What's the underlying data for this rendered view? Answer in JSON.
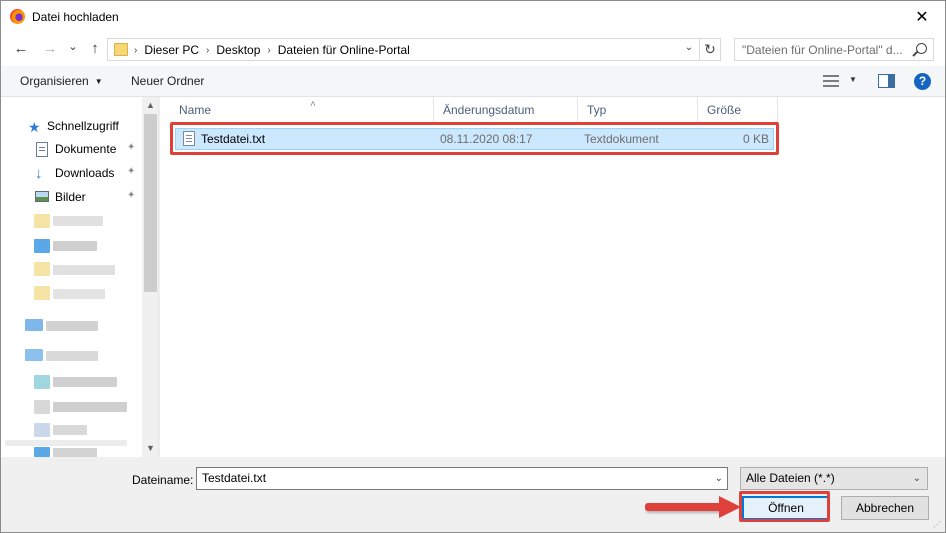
{
  "window": {
    "title": "Datei hochladen",
    "close_glyph": "✕"
  },
  "navigation": {
    "back_glyph": "←",
    "forward_glyph": "→",
    "recent_glyph": "⌄",
    "up_glyph": "↑",
    "breadcrumb": [
      "Dieser PC",
      "Desktop",
      "Dateien für Online-Portal"
    ],
    "refresh_glyph": "↻",
    "search_placeholder": "\"Dateien für Online-Portal\" d..."
  },
  "toolbar": {
    "organize_label": "Organisieren",
    "new_folder_label": "Neuer Ordner",
    "help_label": "?"
  },
  "sidebar": {
    "items": [
      {
        "label": "Schnellzugriff",
        "icon": "star-icon"
      },
      {
        "label": "Dokumente",
        "icon": "document-icon",
        "pinned": true
      },
      {
        "label": "Downloads",
        "icon": "download-icon",
        "pinned": true
      },
      {
        "label": "Bilder",
        "icon": "pictures-icon",
        "pinned": true
      }
    ],
    "pin_glyph": "📌"
  },
  "file_list": {
    "columns": [
      "Name",
      "Änderungsdatum",
      "Typ",
      "Größe"
    ],
    "files": [
      {
        "name": "Testdatei.txt",
        "modified": "08.11.2020 08:17",
        "type": "Textdokument",
        "size": "0 KB",
        "selected": true
      }
    ]
  },
  "footer": {
    "filename_label": "Dateiname:",
    "filename_value": "Testdatei.txt",
    "filter_value": "Alle Dateien (*.*)",
    "open_label": "Öffnen",
    "cancel_label": "Abbrechen"
  },
  "colors": {
    "accent": "#0078d7",
    "selection": "#cce8ff",
    "annotation_red": "#e0403a"
  }
}
